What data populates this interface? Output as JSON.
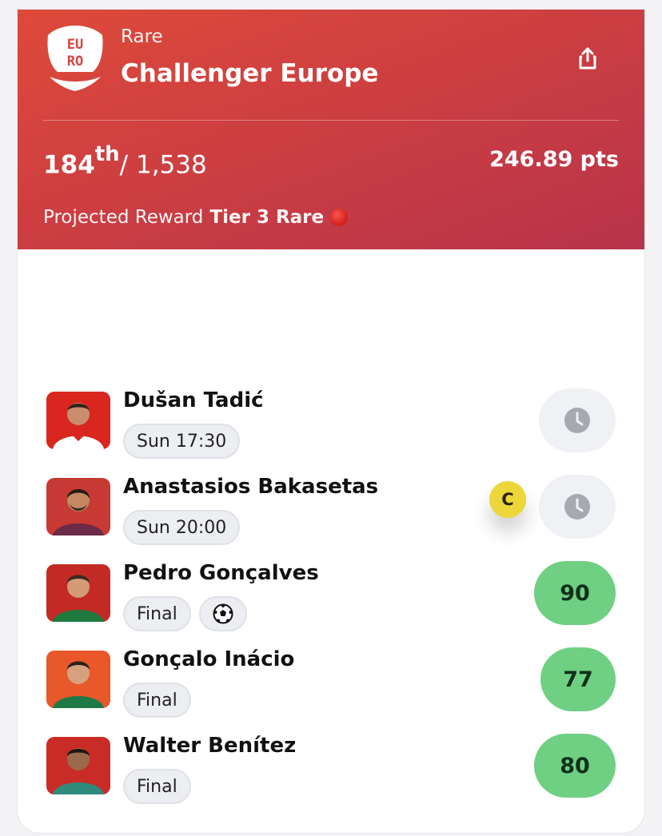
{
  "competition": {
    "rarity": "Rare",
    "title": "Challenger Europe",
    "logo_text": "EURO",
    "rank": "184",
    "rank_suffix": "th",
    "total": "/ 1,538",
    "points": "246.89 pts",
    "reward_label": "Projected Reward",
    "reward_value": "Tier 3 Rare"
  },
  "icons": {
    "share": "share-icon",
    "clock": "clock-icon",
    "goal": "soccer-ball-icon"
  },
  "colors": {
    "header_gradient_start": "#de4a3a",
    "header_gradient_end": "#b8334a",
    "score_green": "#6fcf83",
    "captain_yellow": "#ecd63a",
    "rare_dot": "#d8231d"
  },
  "players": [
    {
      "name": "Dušan Tadić",
      "chips": [
        "Sun 17:30"
      ],
      "status": "pending"
    },
    {
      "name": "Anastasios Bakasetas",
      "chips": [
        "Sun 20:00"
      ],
      "status": "pending",
      "captain": "C"
    },
    {
      "name": "Pedro Gonçalves",
      "chips": [
        "Final"
      ],
      "goal_icon": true,
      "score": "90"
    },
    {
      "name": "Gonçalo Inácio",
      "chips": [
        "Final"
      ],
      "score": "77"
    },
    {
      "name": "Walter Benítez",
      "chips": [
        "Final"
      ],
      "score": "80"
    }
  ]
}
